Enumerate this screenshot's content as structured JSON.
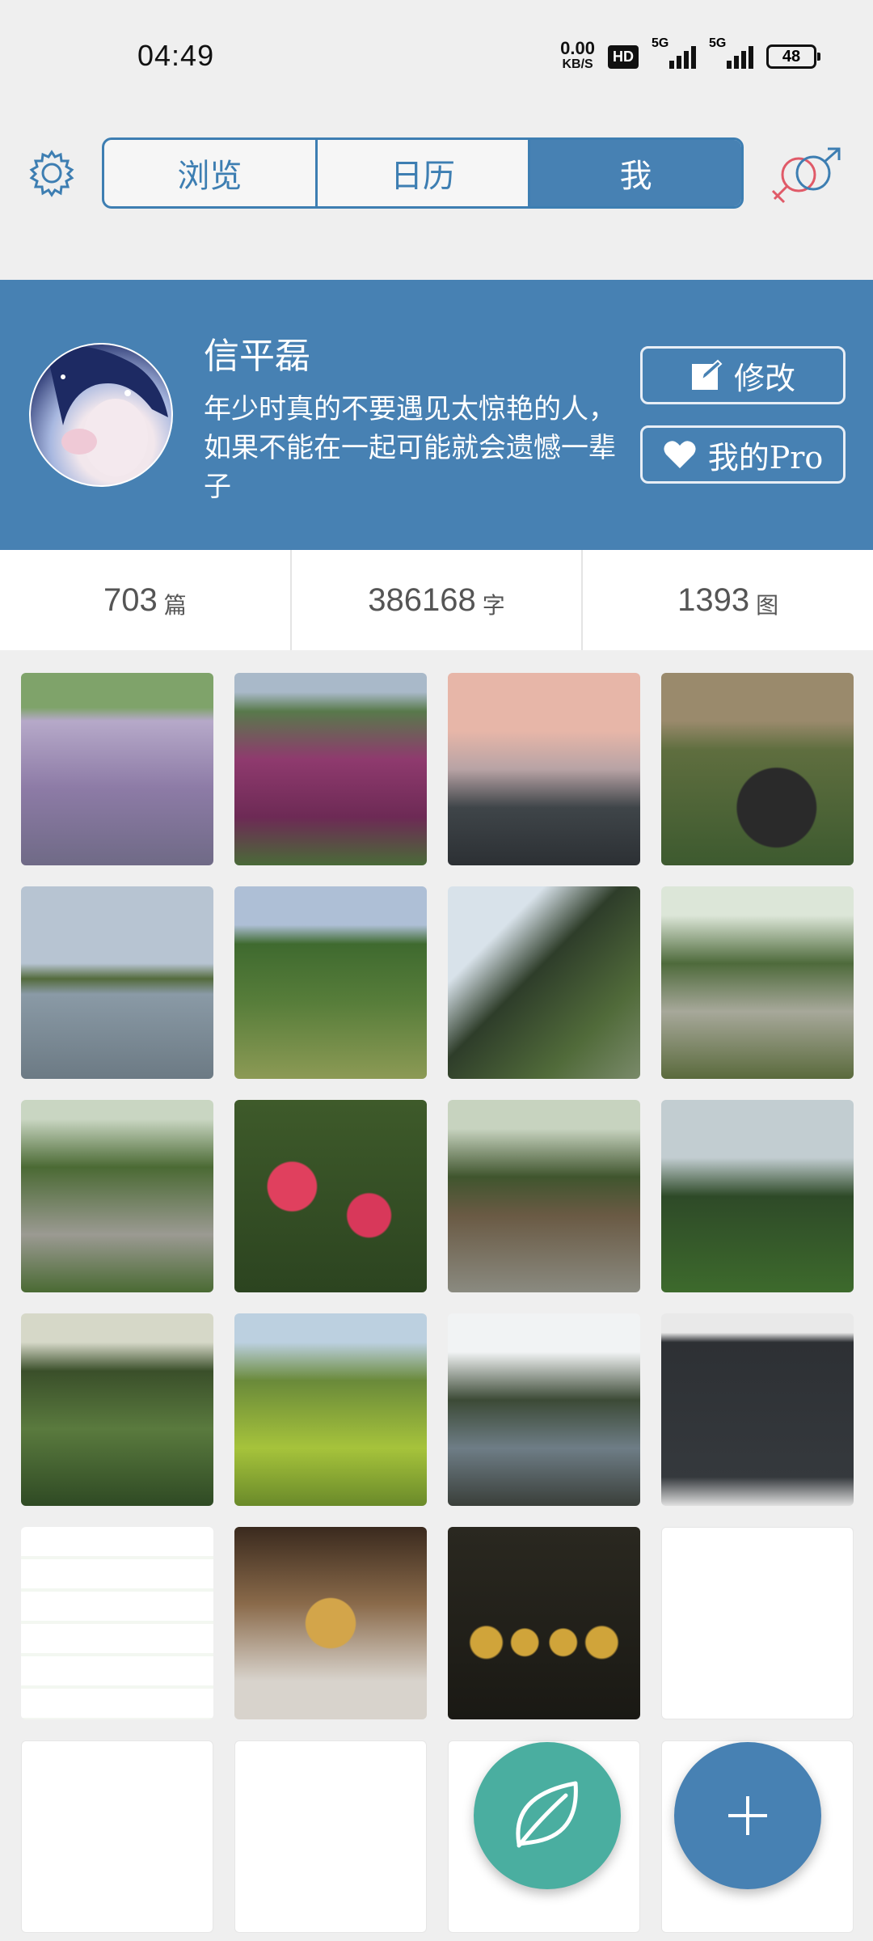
{
  "status_bar": {
    "time": "04:49",
    "net_speed": "0.00",
    "net_unit": "KB/S",
    "hd_badge": "HD",
    "sim1": "5G",
    "sim2": "5G",
    "battery": "48"
  },
  "nav": {
    "settings_icon": "gear-icon",
    "tabs": [
      {
        "label": "浏览",
        "active": false
      },
      {
        "label": "日历",
        "active": false
      },
      {
        "label": "我",
        "active": true
      }
    ],
    "gender_icon": "gender-icon"
  },
  "profile": {
    "name": "信平磊",
    "bio": "年少时真的不要遇见太惊艳的人，如果不能在一起可能就会遗憾一辈子",
    "edit_label": "修改",
    "pro_label": "我的Pro"
  },
  "stats": [
    {
      "value": "703",
      "unit": "篇"
    },
    {
      "value": "386168",
      "unit": "字"
    },
    {
      "value": "1393",
      "unit": "图"
    }
  ],
  "photos": [
    {
      "desc": "lavender-field"
    },
    {
      "desc": "purple-flowers"
    },
    {
      "desc": "sunset-road"
    },
    {
      "desc": "statues"
    },
    {
      "desc": "lake-reflection"
    },
    {
      "desc": "wetland-trees"
    },
    {
      "desc": "forest-path"
    },
    {
      "desc": "winding-path"
    },
    {
      "desc": "tree-path"
    },
    {
      "desc": "red-spider-lily"
    },
    {
      "desc": "stone-path-forest"
    },
    {
      "desc": "meadow-trees"
    },
    {
      "desc": "lotus-pond"
    },
    {
      "desc": "pond-with-walkway"
    },
    {
      "desc": "river-reflection"
    },
    {
      "desc": "license-cover"
    },
    {
      "desc": "exam-scores"
    },
    {
      "desc": "game-badge"
    },
    {
      "desc": "game-trophies"
    },
    {
      "desc": "quiz-question"
    },
    {
      "desc": "quiz-question-2"
    },
    {
      "desc": "quiz-question-3"
    },
    {
      "desc": "quiz-question-4"
    },
    {
      "desc": "chat-list"
    }
  ],
  "fabs": {
    "leaf_icon": "leaf-icon",
    "add_icon": "plus-icon"
  }
}
